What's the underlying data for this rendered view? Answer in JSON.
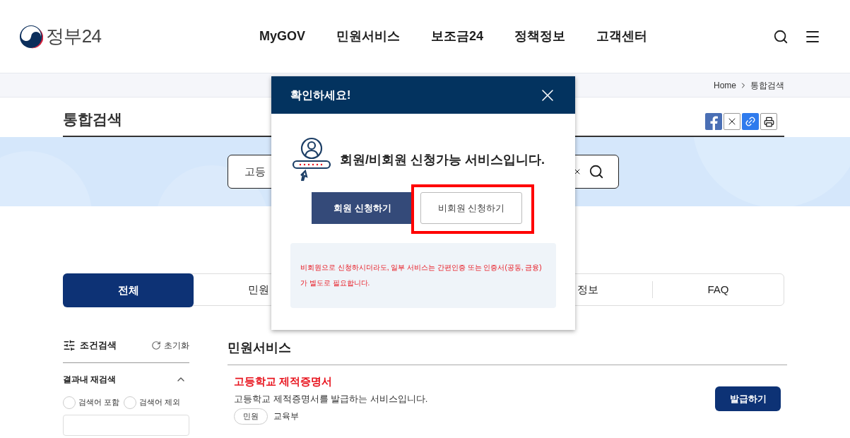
{
  "header": {
    "logo": "정부24",
    "nav": [
      "MyGOV",
      "민원서비스",
      "보조금24",
      "정책정보",
      "고객센터"
    ]
  },
  "breadcrumb": [
    "Home",
    "통합검색"
  ],
  "page_title": "통합검색",
  "search": {
    "value": "고등"
  },
  "tabs": [
    {
      "label": "전체",
      "selected": true
    },
    {
      "label": "민원",
      "selected": false
    },
    {
      "label": "정보",
      "selected": false
    },
    {
      "label": "FAQ",
      "selected": false
    }
  ],
  "filter": {
    "title": "조건검색",
    "reset": "초기화",
    "section": "결과내 재검색",
    "expanded": true,
    "options": [
      {
        "label": "검색어 포함",
        "selected": false
      },
      {
        "label": "검색어 제외",
        "selected": false
      }
    ]
  },
  "results": {
    "heading": "민원서비스",
    "items": [
      {
        "title": "고등학교 제적증명서",
        "description": "고등학교 제적증명서를 발급하는 서비스입니다.",
        "tag": "민원",
        "agency": "교육부",
        "action": "발급하기"
      }
    ]
  },
  "dialog": {
    "title": "확인하세요!",
    "message": "회원/비회원 신청가능 서비스입니다.",
    "buttons": [
      {
        "label": "회원 신청하기",
        "kind": "primary",
        "highlighted": false
      },
      {
        "label": "비회원 신청하기",
        "kind": "secondary",
        "highlighted": true
      }
    ],
    "notice": "비회원으로 신청하시더라도, 일부 서비스는 간편인증 또는 인증서(공동, 금융)가 별도로 필요합니다."
  }
}
